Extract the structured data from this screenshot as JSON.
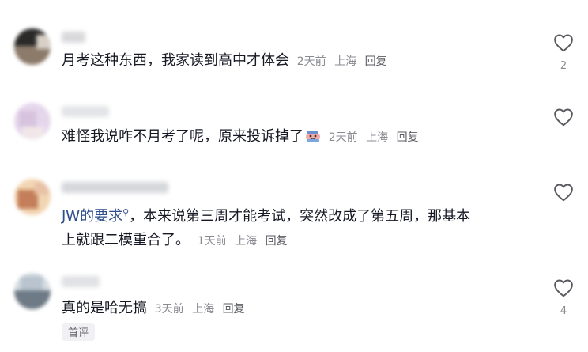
{
  "comments": [
    {
      "text": "月考这种东西，我家读到高中才体会",
      "time": "2天前",
      "location": "上海",
      "reply": "回复",
      "likes": "2",
      "avatar_colors": [
        "#2b2a29",
        "#8c7a6a",
        "#d8cfc6"
      ]
    },
    {
      "text": "难怪我说咋不月考了呢，原来投诉掉了",
      "time": "2天前",
      "location": "上海",
      "reply": "回复",
      "likes": "",
      "avatar_colors": [
        "#e6d6ec",
        "#d7c3df",
        "#f1e6e8"
      ]
    },
    {
      "mention": "JW的要求",
      "mention_icon": "search-icon",
      "text_line1": "，本来说第三周才能考试，突然改成了第五周，那基本",
      "text_line2": "上就跟二模重合了。",
      "time": "1天前",
      "location": "上海",
      "reply": "回复",
      "likes": "",
      "avatar_colors": [
        "#c47f5a",
        "#e8c2a6",
        "#f2d6b3"
      ]
    },
    {
      "text": "真的是哈无搞",
      "time": "3天前",
      "location": "上海",
      "reply": "回复",
      "likes": "4",
      "badge": "首评",
      "avatar_colors": [
        "#b9c4cf",
        "#6e7a85",
        "#d7dde3"
      ]
    }
  ],
  "icons": {
    "like": "heart-outline-icon",
    "emoji": "crying-face-emoji-icon"
  }
}
